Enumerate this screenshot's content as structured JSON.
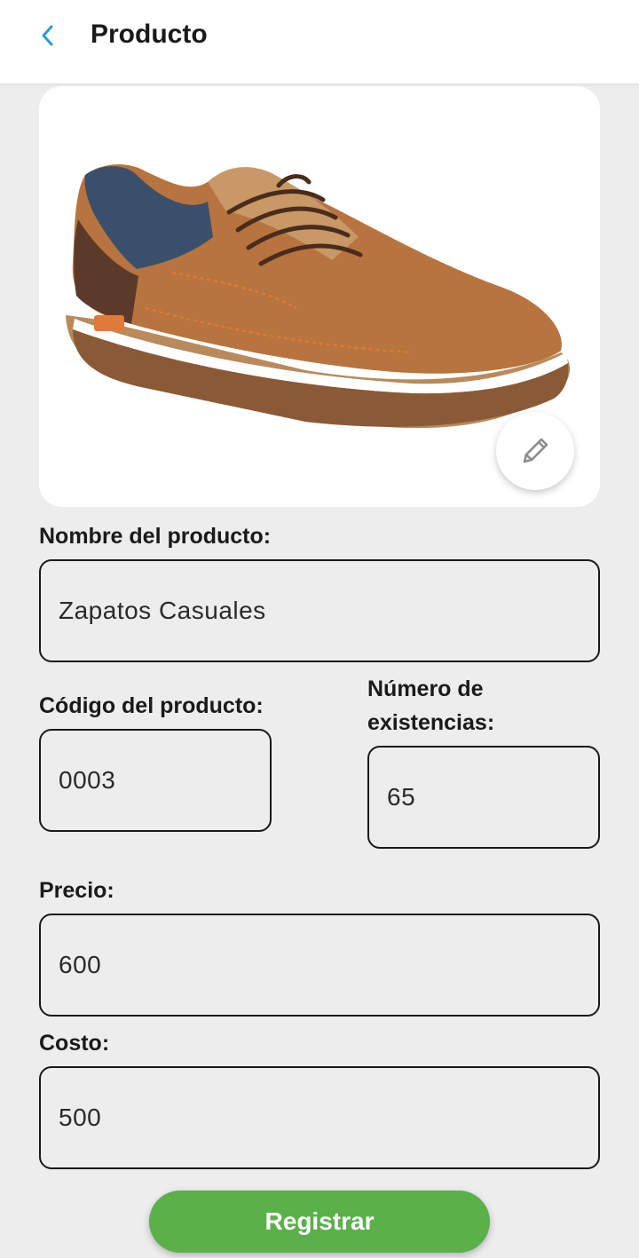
{
  "header": {
    "title": "Producto",
    "back_icon": "chevron-left-icon",
    "back_color": "#2b9ad6"
  },
  "image_card": {
    "image_subject": "product photo",
    "edit_icon": "pencil-icon"
  },
  "form": {
    "name": {
      "label": "Nombre del producto:",
      "value": "Zapatos Casuales"
    },
    "code": {
      "label": "Código del producto:",
      "value": "0003"
    },
    "stock": {
      "label_line1": "Número de",
      "label_line2": "existencias:",
      "value": "65"
    },
    "price": {
      "label": "Precio:",
      "value": "600"
    },
    "cost": {
      "label": "Costo:",
      "value": "500"
    }
  },
  "actions": {
    "submit_label": "Registrar",
    "submit_color": "#5bb04a"
  }
}
